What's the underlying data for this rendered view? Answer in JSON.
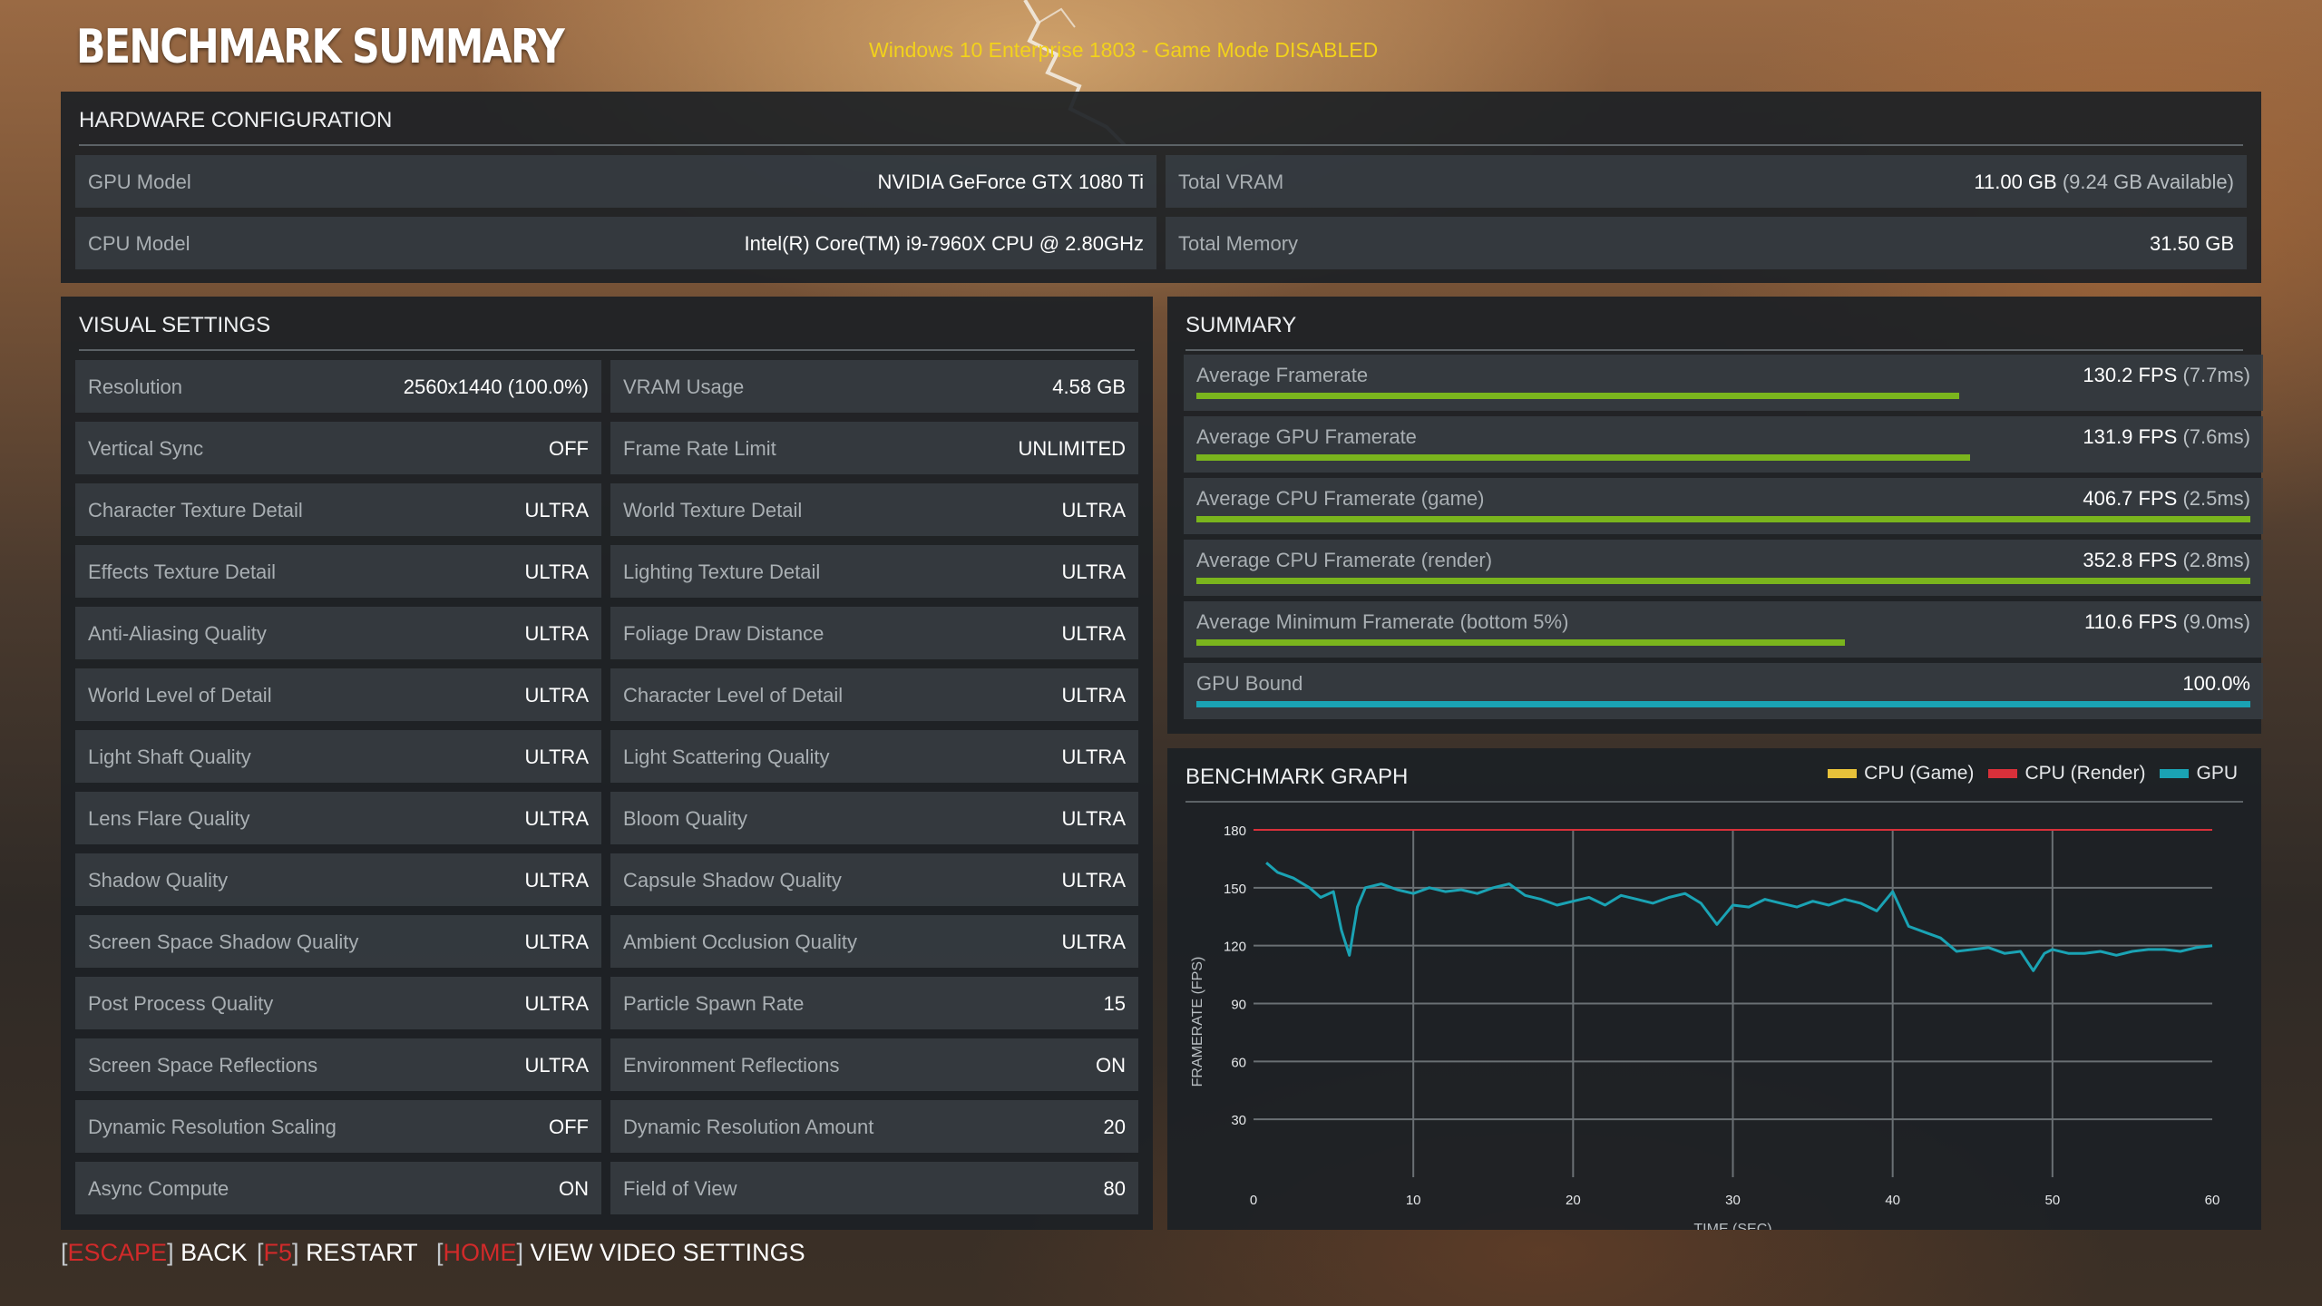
{
  "title": "BENCHMARK SUMMARY",
  "os_note": "Windows 10 Enterprise 1803 - Game Mode DISABLED",
  "hardware": {
    "title": "HARDWARE CONFIGURATION",
    "gpu_label": "GPU Model",
    "gpu_value": "NVIDIA GeForce GTX 1080 Ti",
    "cpu_label": "CPU Model",
    "cpu_value": "Intel(R) Core(TM) i9-7960X CPU @ 2.80GHz",
    "vram_label": "Total VRAM",
    "vram_value": "11.00 GB",
    "vram_sub": "(9.24 GB Available)",
    "mem_label": "Total Memory",
    "mem_value": "31.50 GB"
  },
  "visual": {
    "title": "VISUAL SETTINGS",
    "left": [
      {
        "label": "Resolution",
        "value": "2560x1440 (100.0%)"
      },
      {
        "label": "Vertical Sync",
        "value": "OFF"
      },
      {
        "label": "Character Texture Detail",
        "value": "ULTRA"
      },
      {
        "label": "Effects Texture Detail",
        "value": "ULTRA"
      },
      {
        "label": "Anti-Aliasing Quality",
        "value": "ULTRA"
      },
      {
        "label": "World Level of Detail",
        "value": "ULTRA"
      },
      {
        "label": "Light Shaft Quality",
        "value": "ULTRA"
      },
      {
        "label": "Lens Flare Quality",
        "value": "ULTRA"
      },
      {
        "label": "Shadow Quality",
        "value": "ULTRA"
      },
      {
        "label": "Screen Space Shadow Quality",
        "value": "ULTRA"
      },
      {
        "label": "Post Process Quality",
        "value": "ULTRA"
      },
      {
        "label": "Screen Space Reflections",
        "value": "ULTRA"
      },
      {
        "label": "Dynamic Resolution Scaling",
        "value": "OFF"
      },
      {
        "label": "Async Compute",
        "value": "ON"
      }
    ],
    "right": [
      {
        "label": "VRAM Usage",
        "value": "4.58 GB"
      },
      {
        "label": "Frame Rate Limit",
        "value": "UNLIMITED"
      },
      {
        "label": "World Texture Detail",
        "value": "ULTRA"
      },
      {
        "label": "Lighting Texture Detail",
        "value": "ULTRA"
      },
      {
        "label": "Foliage Draw Distance",
        "value": "ULTRA"
      },
      {
        "label": "Character Level of Detail",
        "value": "ULTRA"
      },
      {
        "label": "Light Scattering Quality",
        "value": "ULTRA"
      },
      {
        "label": "Bloom Quality",
        "value": "ULTRA"
      },
      {
        "label": "Capsule Shadow Quality",
        "value": "ULTRA"
      },
      {
        "label": "Ambient Occlusion Quality",
        "value": "ULTRA"
      },
      {
        "label": "Particle Spawn Rate",
        "value": "15"
      },
      {
        "label": "Environment Reflections",
        "value": "ON"
      },
      {
        "label": "Dynamic Resolution Amount",
        "value": "20"
      },
      {
        "label": "Field of View",
        "value": "80"
      }
    ]
  },
  "summary": {
    "title": "SUMMARY",
    "rows": [
      {
        "label": "Average Framerate",
        "value": "130.2 FPS",
        "sub": "(7.7ms)",
        "bar": 0.724,
        "color": "#7ab51d"
      },
      {
        "label": "Average GPU Framerate",
        "value": "131.9 FPS",
        "sub": "(7.6ms)",
        "bar": 0.734,
        "color": "#7ab51d"
      },
      {
        "label": "Average CPU Framerate (game)",
        "value": "406.7 FPS",
        "sub": "(2.5ms)",
        "bar": 1.0,
        "color": "#7ab51d"
      },
      {
        "label": "Average CPU Framerate (render)",
        "value": "352.8 FPS",
        "sub": "(2.8ms)",
        "bar": 1.0,
        "color": "#7ab51d"
      },
      {
        "label": "Average Minimum Framerate (bottom 5%)",
        "value": "110.6 FPS",
        "sub": "(9.0ms)",
        "bar": 0.615,
        "color": "#7ab51d"
      },
      {
        "label": "GPU Bound",
        "value": "100.0%",
        "sub": "",
        "bar": 1.0,
        "color": "#1aa3b4"
      }
    ]
  },
  "graph": {
    "title": "BENCHMARK GRAPH",
    "legend": [
      {
        "name": "CPU (Game)",
        "color": "#e8c23a"
      },
      {
        "name": "CPU (Render)",
        "color": "#d8303a"
      },
      {
        "name": "GPU",
        "color": "#1aa3b4"
      }
    ]
  },
  "chart_data": {
    "type": "line",
    "title": "BENCHMARK GRAPH",
    "xlabel": "TIME (SEC)",
    "ylabel": "FRAMERATE (FPS)",
    "xlim": [
      0,
      60
    ],
    "ylim": [
      0,
      180
    ],
    "x_ticks": [
      0,
      10,
      20,
      30,
      40,
      50,
      60
    ],
    "y_ticks": [
      30,
      60,
      90,
      120,
      150,
      180
    ],
    "grid": true,
    "legend_position": "top-right",
    "series": [
      {
        "name": "CPU (Game)",
        "color": "#e8c23a",
        "x": [
          0,
          60
        ],
        "y": [
          180,
          180
        ]
      },
      {
        "name": "CPU (Render)",
        "color": "#d8303a",
        "x": [
          0,
          60
        ],
        "y": [
          180,
          180
        ]
      },
      {
        "name": "GPU",
        "color": "#1aa3b4",
        "x": [
          0.8,
          1.5,
          2.5,
          3.5,
          4.2,
          5.0,
          5.5,
          6.0,
          6.5,
          7.0,
          8,
          9,
          10,
          11,
          12,
          13,
          14,
          15,
          16,
          17,
          18,
          19,
          20,
          21,
          22,
          23,
          24,
          25,
          26,
          27,
          28,
          29,
          30,
          31,
          32,
          33,
          34,
          35,
          36,
          37,
          38,
          39,
          40,
          41,
          42,
          43,
          44,
          45,
          46,
          47,
          48,
          48.8,
          49.5,
          50,
          51,
          52,
          53,
          54,
          55,
          56,
          57,
          58,
          59,
          60
        ],
        "y": [
          163,
          158,
          155,
          150,
          145,
          148,
          128,
          115,
          140,
          150,
          152,
          149,
          147,
          150,
          148,
          149,
          147,
          150,
          152,
          146,
          144,
          141,
          143,
          145,
          141,
          146,
          144,
          142,
          145,
          147,
          142,
          131,
          141,
          140,
          144,
          142,
          140,
          143,
          141,
          144,
          142,
          138,
          148,
          130,
          127,
          124,
          117,
          118,
          119,
          116,
          117,
          107,
          116,
          118,
          116,
          116,
          117,
          115,
          117,
          118,
          118,
          117,
          119,
          120
        ]
      }
    ]
  },
  "nav": [
    {
      "key": "ESCAPE",
      "label": "BACK"
    },
    {
      "key": "F5",
      "label": "RESTART"
    },
    {
      "key": "HOME",
      "label": "VIEW VIDEO SETTINGS"
    }
  ]
}
